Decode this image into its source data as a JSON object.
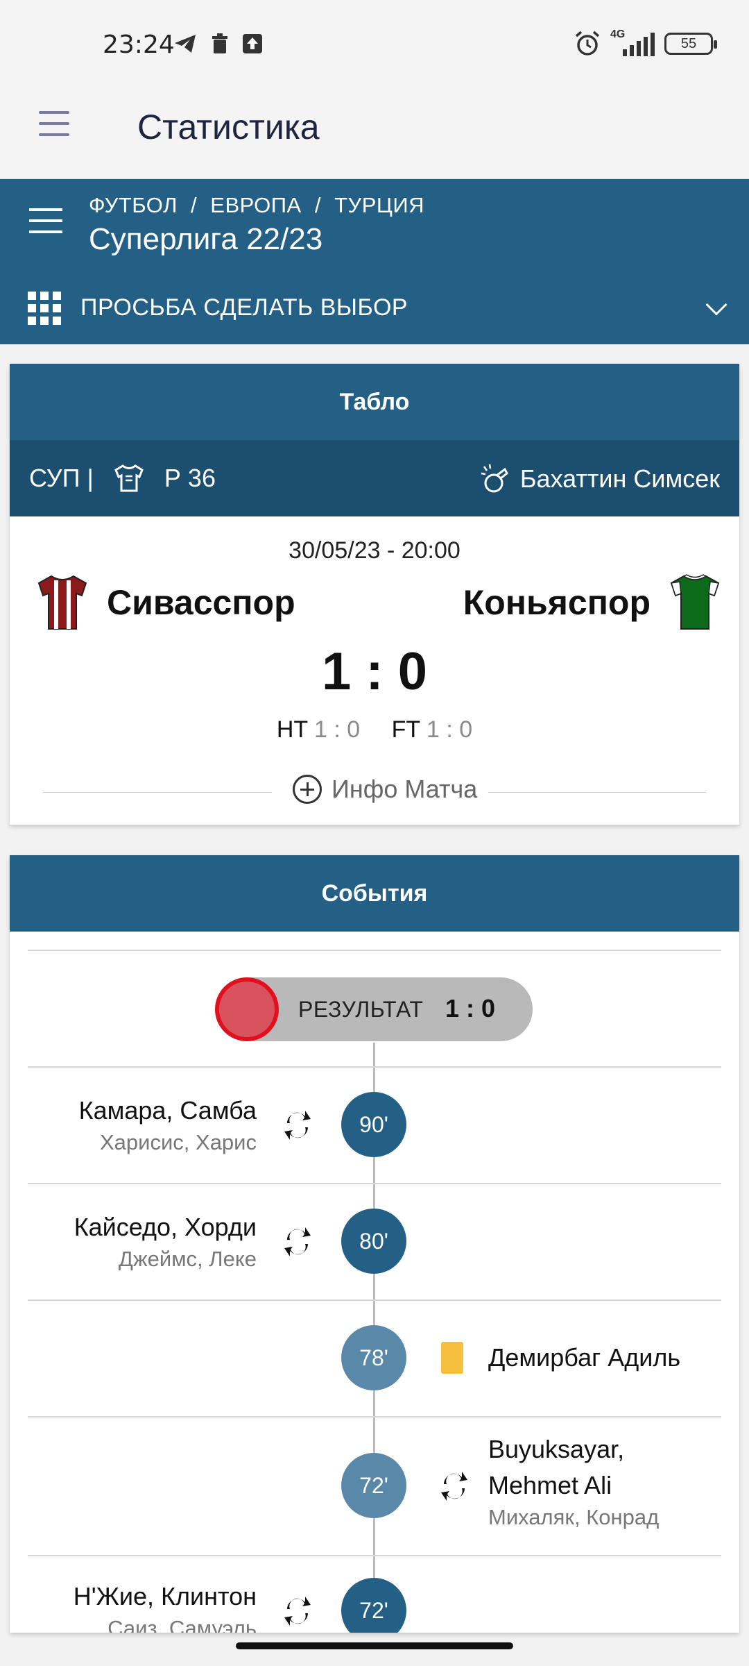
{
  "status_bar": {
    "time": "23:24",
    "network": "4G",
    "battery": "55"
  },
  "app_bar": {
    "title": "Статистика"
  },
  "header": {
    "breadcrumbs": [
      "ФУТБОЛ",
      "/",
      "ЕВРОПА",
      "/",
      "ТУРЦИЯ"
    ],
    "league": "Суперлига 22/23",
    "selector_label": "ПРОСЬБА СДЕЛАТЬ ВЫБОР"
  },
  "scoreboard": {
    "title": "Табло",
    "competition": "СУП |",
    "round": "Р 36",
    "referee": "Бахаттин Симсек",
    "datetime": "30/05/23 - 20:00",
    "home": {
      "name": "Сивасспор",
      "shirt_color": "#8b1a1a",
      "stripe_color": "#ffffff"
    },
    "away": {
      "name": "Коньяспор",
      "shirt_color": "#0c6a1a",
      "collar_color": "#ffffff"
    },
    "score": "1 : 0",
    "ht_label": "HT",
    "ht_score": "1 : 0",
    "ft_label": "FT",
    "ft_score": "1 : 0",
    "info_label": "Инфо Матча"
  },
  "events": {
    "title": "События",
    "result_label": "РЕЗУЛЬТАТ",
    "result_score": "1 : 0",
    "items": [
      {
        "minute": "90'",
        "side": "home",
        "type": "substitution",
        "player_in": "Камара, Самба",
        "player_out": "Харисис, Харис"
      },
      {
        "minute": "80'",
        "side": "home",
        "type": "substitution",
        "player_in": "Кайседо, Хорди",
        "player_out": "Джеймс, Леке"
      },
      {
        "minute": "78'",
        "side": "away",
        "type": "yellow-card",
        "player": "Демирбаг Адиль"
      },
      {
        "minute": "72'",
        "side": "away",
        "type": "substitution",
        "player_in_line1": "Buyuksayar,",
        "player_in_line2": "Mehmet Ali",
        "player_out": "Михаляк, Конрад"
      },
      {
        "minute": "72'",
        "side": "home",
        "type": "substitution",
        "player_in": "Н'Жие, Клинтон",
        "player_out": "Саиз, Самуэль"
      }
    ]
  }
}
